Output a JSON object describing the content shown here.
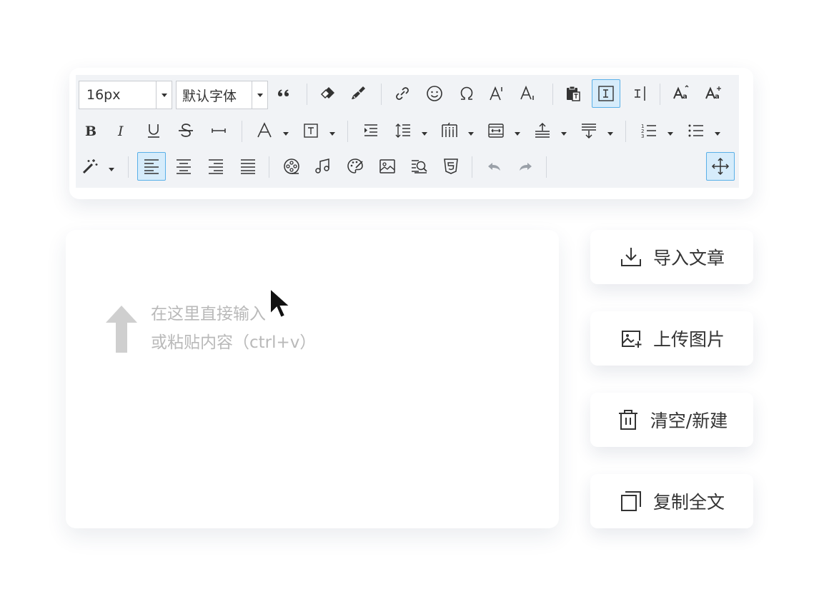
{
  "toolbar": {
    "font_size": "16px",
    "font_family": "默认字体"
  },
  "editor": {
    "hint_line1": "在这里直接输入",
    "hint_line2": "或粘贴内容（ctrl+v）"
  },
  "side_buttons": {
    "import": "导入文章",
    "upload": "上传图片",
    "clear": "清空/新建",
    "copy": "复制全文"
  },
  "colors": {
    "toolbar_bg": "#f1f3f6",
    "active_bg": "#d6ecfb",
    "active_border": "#5ab0e8",
    "icon": "#333333",
    "hint": "#b9b9b9"
  },
  "icons": {
    "row1": [
      "quote-icon",
      "eraser-icon",
      "format-painter-icon",
      "link-icon",
      "emoji-icon",
      "omega-icon",
      "superscript-icon",
      "subscript-icon",
      "paste-text-icon",
      "indent-left-icon",
      "indent-right-icon",
      "uppercase-icon",
      "lowercase-icon"
    ],
    "row2": [
      "bold-icon",
      "italic-icon",
      "underline-icon",
      "strikethrough-icon",
      "horizontal-rule-icon",
      "font-color-icon",
      "background-color-icon",
      "indent-icon",
      "line-height-icon",
      "letter-spacing-icon",
      "paragraph-spacing-icon",
      "spacing-before-icon",
      "spacing-after-icon",
      "ordered-list-icon",
      "unordered-list-icon"
    ],
    "row3": [
      "magic-wand-icon",
      "align-left-icon",
      "align-center-icon",
      "align-right-icon",
      "justify-icon",
      "video-icon",
      "music-icon",
      "palette-icon",
      "image-icon",
      "search-replace-icon",
      "html5-icon",
      "undo-icon",
      "redo-icon",
      "move-icon"
    ]
  }
}
